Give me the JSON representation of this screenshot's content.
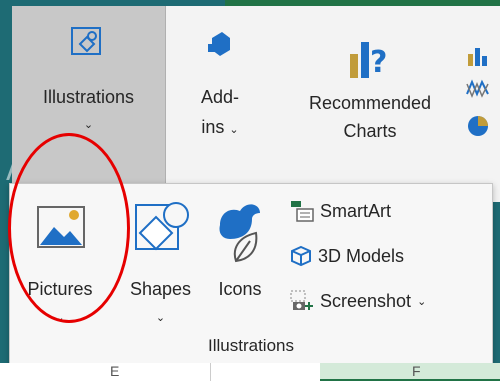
{
  "ribbon": {
    "illustrations_line1": "Illustrations",
    "addins_line1": "Add-",
    "addins_line2": "ins",
    "recommended_line1": "Recommended",
    "recommended_line2": "Charts"
  },
  "panel": {
    "pictures_label": "Pictures",
    "shapes_label": "Shapes",
    "icons_label": "Icons",
    "smartart_label": "SmartArt",
    "models3d_label": "3D Models",
    "screenshot_label": "Screenshot",
    "group_label": "Illustrations"
  },
  "sheet": {
    "col_e": "E",
    "col_f": "F"
  },
  "colors": {
    "accent_teal": "#1e6b74",
    "excel_green": "#217346",
    "highlight_red": "#e60000",
    "icon_blue": "#1f6fc5"
  }
}
